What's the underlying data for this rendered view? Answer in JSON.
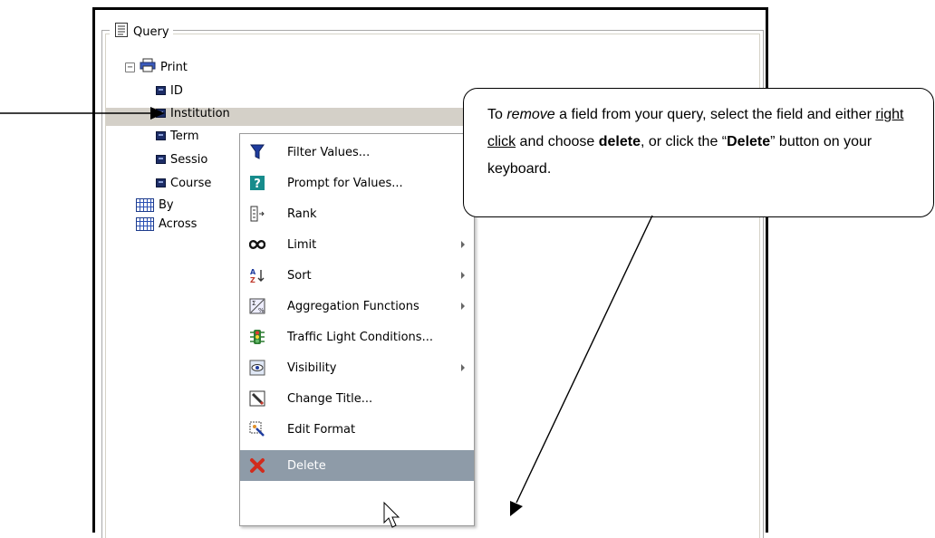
{
  "query_panel": {
    "title": "Query",
    "root": "Print",
    "fields": [
      "ID",
      "Institution",
      "Term",
      "Sessio",
      "Course"
    ],
    "groups": [
      "By",
      "Across"
    ]
  },
  "context_menu": {
    "items": [
      {
        "label": "Filter Values...",
        "icon": "filter-funnel-icon",
        "submenu": false
      },
      {
        "label": "Prompt for Values...",
        "icon": "prompt-icon",
        "submenu": false
      },
      {
        "label": "Rank",
        "icon": "rank-icon",
        "submenu": false
      },
      {
        "label": "Limit",
        "icon": "infinity-icon",
        "submenu": true
      },
      {
        "label": "Sort",
        "icon": "sort-az-icon",
        "submenu": true
      },
      {
        "label": "Aggregation Functions",
        "icon": "aggregation-icon",
        "submenu": true
      },
      {
        "label": "Traffic Light Conditions...",
        "icon": "traffic-light-icon",
        "submenu": false
      },
      {
        "label": "Visibility",
        "icon": "eye-icon",
        "submenu": true
      },
      {
        "label": "Change Title...",
        "icon": "pencil-icon",
        "submenu": false
      },
      {
        "label": "Edit Format",
        "icon": "format-icon",
        "submenu": false
      },
      {
        "label": "Delete",
        "icon": "red-x-icon",
        "submenu": false
      }
    ],
    "active_item": "Delete"
  },
  "callout": {
    "t1": "To ",
    "t2": "remove",
    "t3": " a field from your query, select the field and either ",
    "t4": "right click",
    "t5": " and choose ",
    "t6": "delete",
    "t7": ", or click the “",
    "t8": "Delete",
    "t9": "” button on your keyboard."
  },
  "colors": {
    "selection": "#d4d0c8",
    "menu_active": "#8e9ba8",
    "field_icon": "#1d2d66",
    "delete_x": "#d22b1c"
  }
}
